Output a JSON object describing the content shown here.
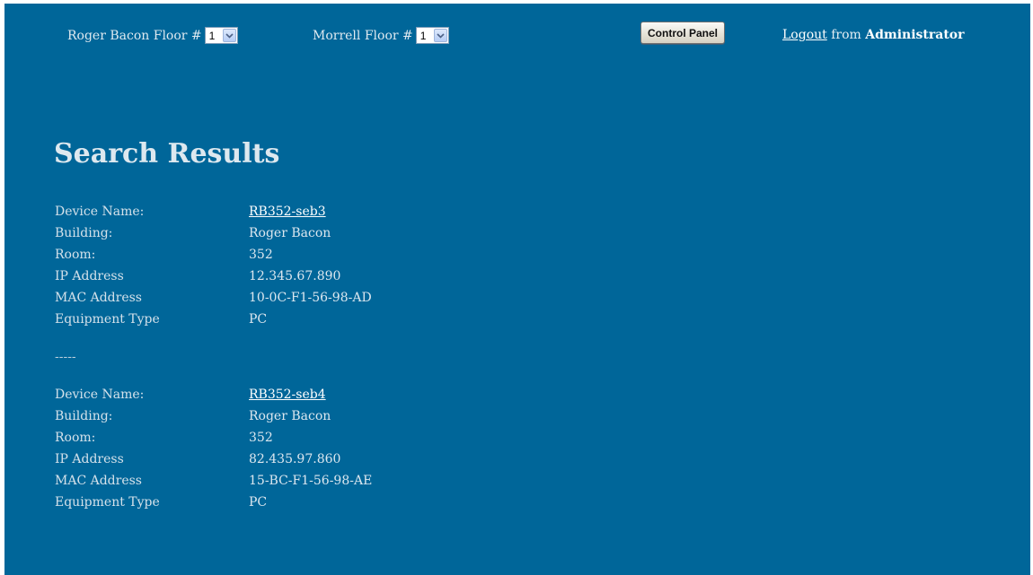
{
  "topbar": {
    "roger_bacon_label": "Roger Bacon Floor #",
    "roger_bacon_floor": "1",
    "morrell_label": "Morrell Floor #",
    "morrell_floor": "1",
    "control_panel_label": "Control Panel",
    "logout_link": "Logout",
    "logout_from": " from ",
    "logout_user": "Administrator"
  },
  "main": {
    "title": "Search Results",
    "separator": "-----",
    "results": [
      {
        "device_name_label": "Device Name:",
        "device_name": "RB352-seb3",
        "building_label": "Building:",
        "building": "Roger Bacon",
        "room_label": "Room:",
        "room": "352",
        "ip_label": "IP Address",
        "ip": "12.345.67.890",
        "mac_label": "MAC Address",
        "mac": "10-0C-F1-56-98-AD",
        "equipment_label": "Equipment Type",
        "equipment": "PC"
      },
      {
        "device_name_label": "Device Name:",
        "device_name": "RB352-seb4",
        "building_label": "Building:",
        "building": "Roger Bacon",
        "room_label": "Room:",
        "room": "352",
        "ip_label": "IP Address",
        "ip": "82.435.97.860",
        "mac_label": "MAC Address",
        "mac": "15-BC-F1-56-98-AE",
        "equipment_label": "Equipment Type",
        "equipment": "PC"
      }
    ]
  },
  "colors": {
    "page_background": "#006699",
    "text": "#dce7ef"
  }
}
